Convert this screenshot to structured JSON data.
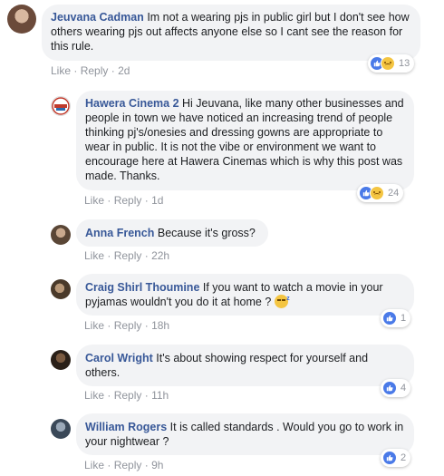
{
  "action_like": "Like",
  "action_reply": "Reply",
  "separator": "·",
  "colors": {
    "author": "#385898",
    "bubble": "#f2f3f5",
    "meta": "#90949c",
    "like_blue": "#4a7ae8"
  },
  "comments": [
    {
      "author": "Jeuvana Cadman",
      "text": "Im not a wearing pjs in public girl but I don't see how others wearing pjs out affects anyone else so I cant see the reason for this rule.",
      "time": "2d",
      "reactions": [
        "like-icon",
        "sad-icon"
      ],
      "reaction_count": "13"
    },
    {
      "author": "Hawera Cinema 2",
      "text": "Hi Jeuvana, like many other businesses and people in town we have noticed an increasing trend of people thinking pj's/onesies and dressing gowns are appropriate to wear in public. It is not the vibe or environment we want to encourage here at Hawera Cinemas which is why this post was made. Thanks.",
      "time": "1d",
      "reactions": [
        "like-icon",
        "sad-icon"
      ],
      "reaction_count": "24"
    },
    {
      "author": "Anna French",
      "text": "Because it's gross?",
      "time": "22h"
    },
    {
      "author": "Craig Shirl Thoumine",
      "text": "If you want to watch a movie in your pyjamas wouldn't you do it at home ?",
      "emoji": "sleeping-face-emoji",
      "time": "18h",
      "reactions": [
        "like-icon"
      ],
      "reaction_count": "1"
    },
    {
      "author": "Carol Wright",
      "text": "It's about showing respect for yourself and others.",
      "time": "11h",
      "reactions": [
        "like-icon"
      ],
      "reaction_count": "4"
    },
    {
      "author": "William Rogers",
      "text": "It is called standards . Would you go to work in your nightwear ?",
      "time": "9h",
      "reactions": [
        "like-icon"
      ],
      "reaction_count": "2"
    }
  ]
}
